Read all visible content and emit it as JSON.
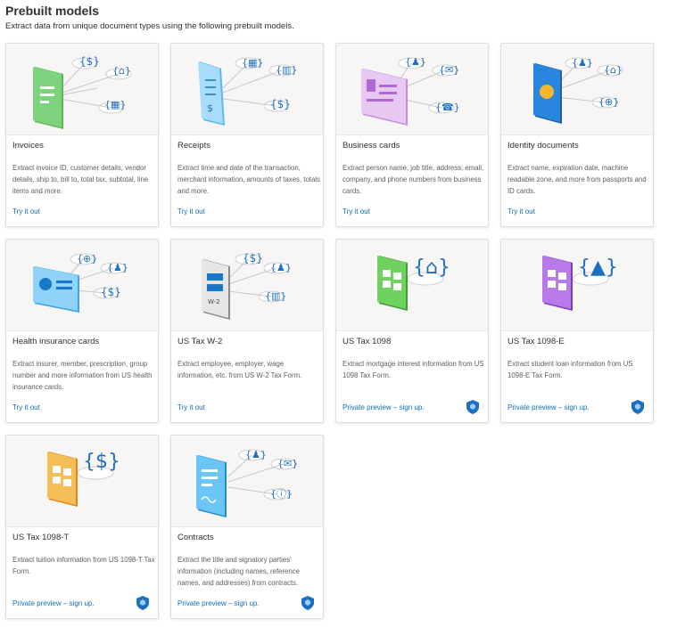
{
  "header": {
    "title": "Prebuilt models",
    "subtitle": "Extract data from unique document types using the following prebuilt models."
  },
  "colors": {
    "link": "#0f6cbd",
    "invoice": "#5bb85b",
    "receipt": "#58b7f0",
    "business": "#c68be0",
    "identity": "#1f7cd0",
    "health": "#3aa5e8",
    "w2": "#9a9a9a",
    "t1098": "#5cc24d",
    "t1098e": "#a661e0",
    "t1098t": "#f0a93a",
    "contracts": "#3ab0ec"
  },
  "cards": [
    {
      "title": "Invoices",
      "desc": "Extract invoice ID, customer details, vendor details, ship to, bill to, total tax, subtotal, line items and more.",
      "link": "Try it out",
      "icon": "invoice-icon",
      "preview": false
    },
    {
      "title": "Receipts",
      "desc": "Extract time and date of the transaction, merchant information, amounts of taxes, totals and more.",
      "link": "Try it out",
      "icon": "receipt-icon",
      "preview": false
    },
    {
      "title": "Business cards",
      "desc": "Extract person name, job title, address, email, company, and phone numbers from business cards.",
      "link": "Try it out",
      "icon": "business-card-icon",
      "preview": false
    },
    {
      "title": "Identity documents",
      "desc": "Extract name, expiration date, machine readable zone, and more from passports and ID cards.",
      "link": "Try it out",
      "icon": "passport-icon",
      "preview": false
    },
    {
      "title": "Health insurance cards",
      "desc": "Extract insurer, member, prescription, group number and more information from US health insurance cards.",
      "link": "Try it out",
      "icon": "health-card-icon",
      "preview": false
    },
    {
      "title": "US Tax W-2",
      "desc": "Extract employee, employer, wage information, etc. from US W-2 Tax Form.",
      "link": "Try it out",
      "icon": "w2-form-icon",
      "preview": false
    },
    {
      "title": "US Tax 1098",
      "desc": "Extract mortgage interest information from US 1098 Tax Form.",
      "link": "Private preview – sign up.",
      "icon": "tax-1098-icon",
      "preview": true
    },
    {
      "title": "US Tax 1098-E",
      "desc": "Extract student loan information from US 1098-E Tax Form.",
      "link": "Private preview – sign up.",
      "icon": "tax-1098e-icon",
      "preview": true
    },
    {
      "title": "US Tax 1098-T",
      "desc": "Extract tuition information from US 1098-T Tax Form.",
      "link": "Private preview – sign up.",
      "icon": "tax-1098t-icon",
      "preview": true
    },
    {
      "title": "Contracts",
      "desc": "Extract the title and signatory parties' information (including names, reference names, and addresses) from contracts.",
      "link": "Private preview – sign up.",
      "icon": "contract-icon",
      "preview": true
    }
  ]
}
